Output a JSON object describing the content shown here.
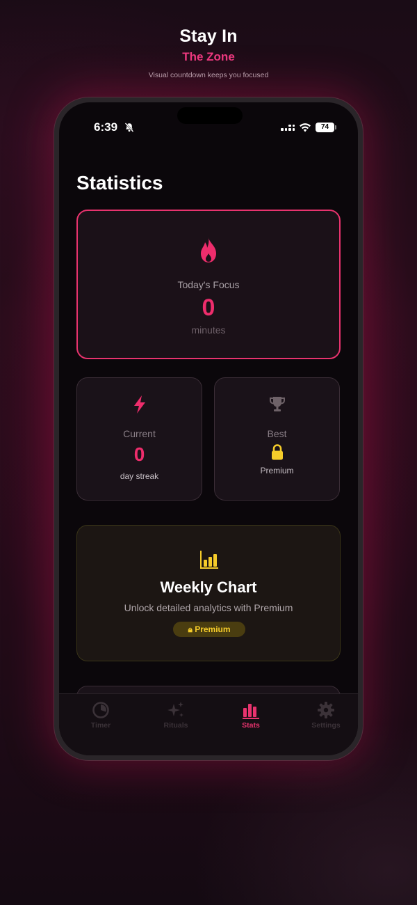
{
  "promo": {
    "headline": "Stay In",
    "subhead": "The Zone",
    "tagline": "Visual countdown keeps you focused"
  },
  "status_bar": {
    "time": "6:39",
    "battery": "74",
    "icons": [
      "bell-slash-icon",
      "signal-icon",
      "wifi-icon",
      "battery-icon"
    ]
  },
  "page": {
    "title": "Statistics"
  },
  "focus": {
    "label": "Today's Focus",
    "value": "0",
    "unit": "minutes",
    "icon": "flame-icon"
  },
  "streak": {
    "label": "Current",
    "value": "0",
    "unit": "day streak",
    "icon": "bolt-icon"
  },
  "best": {
    "label": "Best",
    "unit": "Premium",
    "icon": "trophy-icon"
  },
  "weekly_chart": {
    "title": "Weekly Chart",
    "description": "Unlock detailed analytics with Premium",
    "button": "Premium",
    "icon": "bar-chart-icon"
  },
  "tabs": [
    {
      "label": "Timer",
      "icon": "timer-icon",
      "active": false
    },
    {
      "label": "Rituals",
      "icon": "sparkles-icon",
      "active": false
    },
    {
      "label": "Stats",
      "icon": "stats-icon",
      "active": true
    },
    {
      "label": "Settings",
      "icon": "gear-icon",
      "active": false
    }
  ],
  "colors": {
    "accent": "#e8336e",
    "premium": "#f5cc2a",
    "background": "#0b070b"
  }
}
